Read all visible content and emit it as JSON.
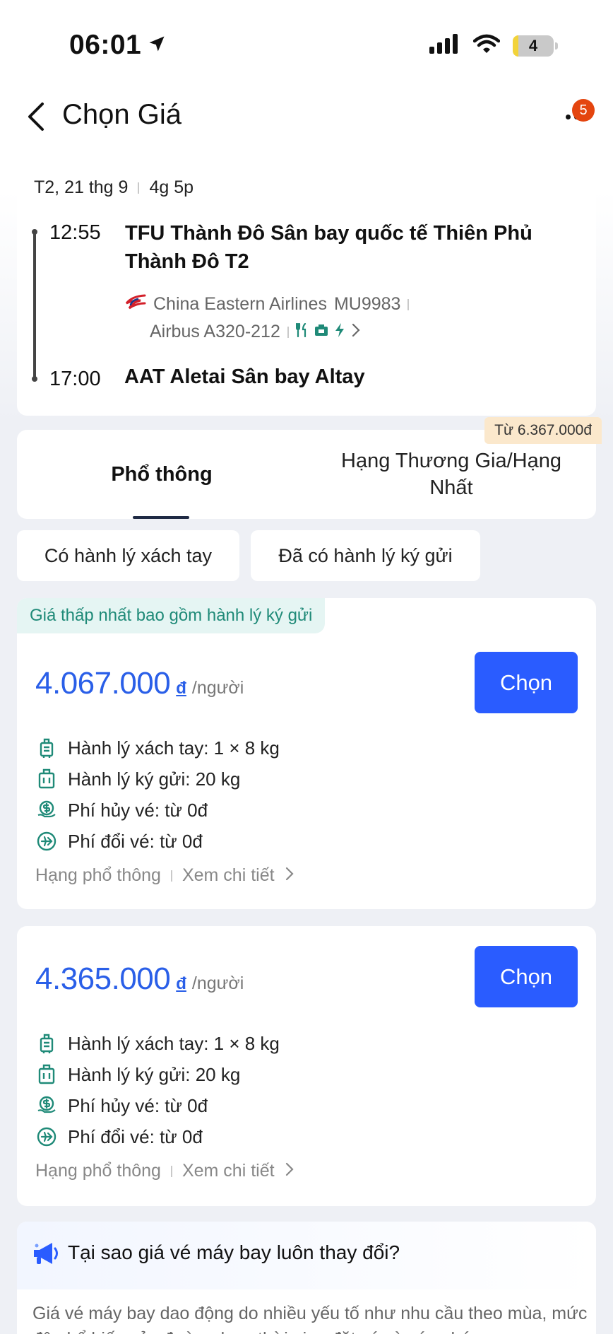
{
  "status_bar": {
    "time": "06:01",
    "battery": "4"
  },
  "nav": {
    "title": "Chọn Giá",
    "badge": "5"
  },
  "flight": {
    "date": "T2, 21 thg 9",
    "duration": "4g 5p",
    "departure_time": "12:55",
    "departure_airport": "TFU Thành Đô Sân bay quốc tế Thiên Phủ Thành Đô T2",
    "airline": "China Eastern Airlines",
    "flight_no": "MU9983",
    "aircraft": "Airbus A320-212",
    "arrival_time": "17:00",
    "arrival_airport": "AAT Aletai Sân bay Altay"
  },
  "cabin_tabs": {
    "economy": "Phổ thông",
    "business": "Hạng Thương Gia/Hạng Nhất",
    "business_price": "Từ 6.367.000đ"
  },
  "filters": {
    "carry_on": "Có hành lý xách tay",
    "checked": "Đã có hành lý ký gửi"
  },
  "fares": [
    {
      "tag": "Giá thấp nhất bao gồm hành lý ký gửi",
      "price": "4.067.000",
      "currency": "đ",
      "per": "/người",
      "select": "Chọn",
      "carry_on": "Hành lý xách tay: 1 × 8 kg",
      "checked": "Hành lý ký gửi: 20 kg",
      "cancel": "Phí hủy vé: từ 0đ",
      "change": "Phí đổi vé: từ 0đ",
      "class": "Hạng phổ thông",
      "details": "Xem chi tiết"
    },
    {
      "price": "4.365.000",
      "currency": "đ",
      "per": "/người",
      "select": "Chọn",
      "carry_on": "Hành lý xách tay: 1 × 8 kg",
      "checked": "Hành lý ký gửi: 20 kg",
      "cancel": "Phí hủy vé: từ 0đ",
      "change": "Phí đổi vé: từ 0đ",
      "class": "Hạng phổ thông",
      "details": "Xem chi tiết"
    }
  ],
  "info": {
    "title": "Tại sao giá vé máy bay luôn thay đổi?",
    "body": "Giá vé máy bay dao động do nhiều yếu tố như nhu cầu theo mùa, mức độ phổ biến của đường bay, thời gian đặt vé và sức chứa"
  },
  "colors": {
    "accent": "#2a5cff",
    "price": "#2a5fe8",
    "tag_text": "#1f8a78",
    "badge": "#e4450f"
  }
}
